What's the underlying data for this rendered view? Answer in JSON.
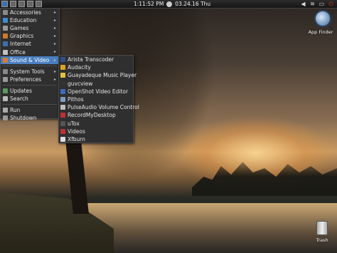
{
  "panel": {
    "time": "1:11:52 PM",
    "date": "03.24.16 Thu",
    "launcher_icons": [
      "menu-icon",
      "file-manager-icon",
      "terminal-icon",
      "browser-icon",
      "files-icon"
    ],
    "tray_icons": [
      "volume-icon",
      "network-icon",
      "battery-icon",
      "power-icon"
    ]
  },
  "desktop_icons": {
    "app_finder": "App Finder",
    "trash": "Trash"
  },
  "main_menu": {
    "categories": [
      {
        "label": "Accessories",
        "icon": "accessories-icon",
        "color": "#8a8a8a"
      },
      {
        "label": "Education",
        "icon": "education-icon",
        "color": "#3a8fd0"
      },
      {
        "label": "Games",
        "icon": "games-icon",
        "color": "#9a9a9a"
      },
      {
        "label": "Graphics",
        "icon": "graphics-icon",
        "color": "#d07a2a"
      },
      {
        "label": "Internet",
        "icon": "internet-icon",
        "color": "#3b6fb3"
      },
      {
        "label": "Office",
        "icon": "office-icon",
        "color": "#c0c0c0"
      },
      {
        "label": "Sound & Video",
        "icon": "sound-video-icon",
        "color": "#e07a2a"
      }
    ],
    "system": [
      {
        "label": "System Tools",
        "icon": "system-tools-icon",
        "color": "#888"
      },
      {
        "label": "Preferences",
        "icon": "preferences-icon",
        "color": "#999"
      }
    ],
    "actions": [
      {
        "label": "Updates",
        "icon": "updates-icon",
        "color": "#5a9a5a"
      },
      {
        "label": "Search",
        "icon": "search-icon",
        "color": "#bbb"
      }
    ],
    "session": [
      {
        "label": "Run",
        "icon": "run-icon",
        "color": "#aaa"
      },
      {
        "label": "Shutdown",
        "icon": "shutdown-icon",
        "color": "#999"
      }
    ]
  },
  "sound_video_menu": {
    "items": [
      {
        "label": "Arista Transcoder",
        "icon": "arista-icon",
        "color": "#2d4f8a"
      },
      {
        "label": "Audacity",
        "icon": "audacity-icon",
        "color": "#e0a020"
      },
      {
        "label": "Guayadeque Music Player",
        "icon": "guayadeque-icon",
        "color": "#e0c040"
      },
      {
        "label": "guvcview",
        "icon": "guvcview-icon",
        "color": "#333"
      },
      {
        "label": "OpenShot Video Editor",
        "icon": "openshot-icon",
        "color": "#3a6ac0"
      },
      {
        "label": "Pithos",
        "icon": "pithos-icon",
        "color": "#7aa0c0"
      },
      {
        "label": "PulseAudio Volume Control",
        "icon": "pulseaudio-icon",
        "color": "#bbb"
      },
      {
        "label": "RecordMyDesktop",
        "icon": "recordmydesktop-icon",
        "color": "#c03030"
      },
      {
        "label": "uTox",
        "icon": "utox-icon",
        "color": "#555"
      },
      {
        "label": "Videos",
        "icon": "videos-icon",
        "color": "#c03030"
      },
      {
        "label": "Xfburn",
        "icon": "xfburn-icon",
        "color": "#ddd"
      }
    ]
  }
}
